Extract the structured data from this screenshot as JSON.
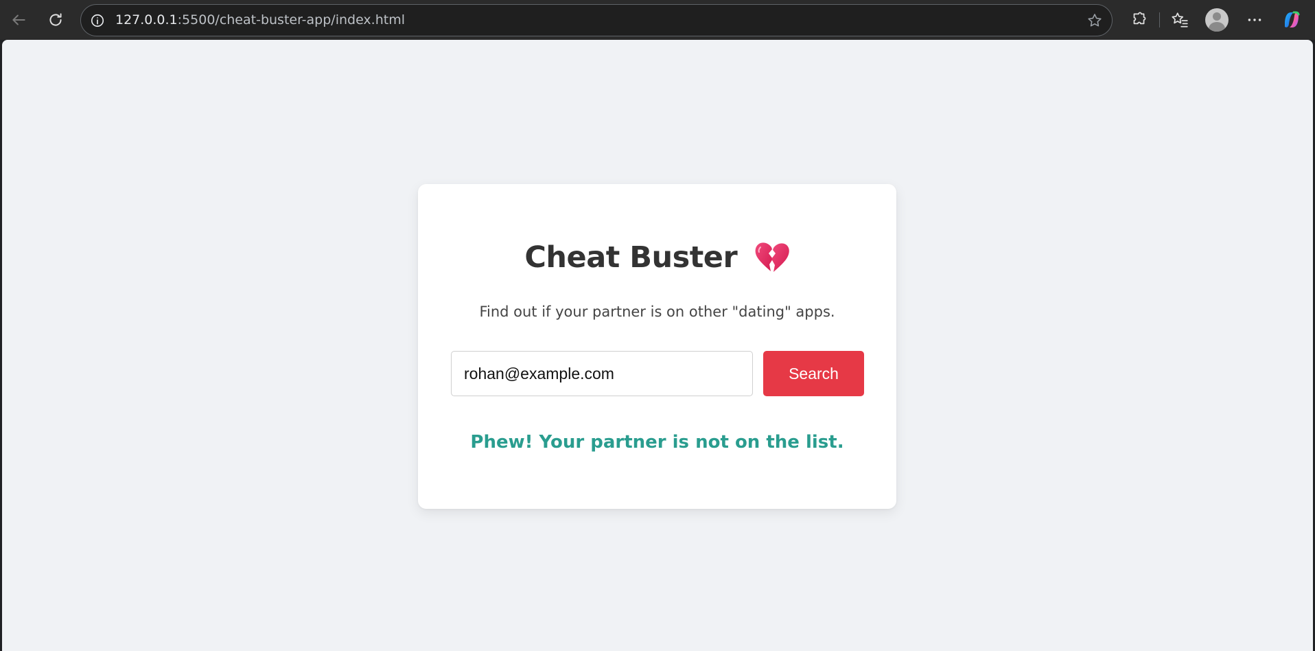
{
  "browser": {
    "url_host": "127.0.0.1",
    "url_rest": ":5500/cheat-buster-app/index.html",
    "icons": {
      "back": "back-arrow-icon",
      "reload": "reload-icon",
      "site_info": "info-icon",
      "favorite": "star-icon",
      "extensions": "puzzle-icon",
      "favorites": "favorites-icon",
      "profile": "avatar",
      "more": "more-icon",
      "copilot": "copilot-icon"
    }
  },
  "page": {
    "title": "Cheat Buster",
    "title_icon": "broken-heart-icon",
    "subtitle": "Find out if your partner is on other \"dating\" apps.",
    "email_value": "rohan@example.com",
    "search_label": "Search",
    "result": "Phew! Your partner is not on the list.",
    "colors": {
      "background": "#f0f2f5",
      "card": "#ffffff",
      "button": "#e63946",
      "result": "#2a9d8f",
      "title": "#333333"
    }
  }
}
